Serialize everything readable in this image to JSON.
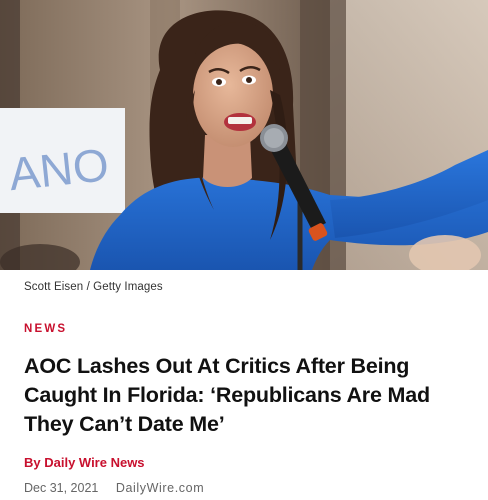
{
  "photo": {
    "credit": "Scott Eisen / Getty Images",
    "description_icon": "news-photo"
  },
  "sign_text": "ANO",
  "article": {
    "category": "NEWS",
    "headline": "AOC Lashes Out At Critics After Being Caught In Florida: ‘Republicans Are Mad They Can’t Date Me’",
    "byline": "By Daily Wire News",
    "date": "Dec 31, 2021",
    "source": "DailyWire.com"
  },
  "colors": {
    "accent_red": "#c8102e",
    "dress_blue": "#1f64c9",
    "meta_gray": "#666666"
  }
}
